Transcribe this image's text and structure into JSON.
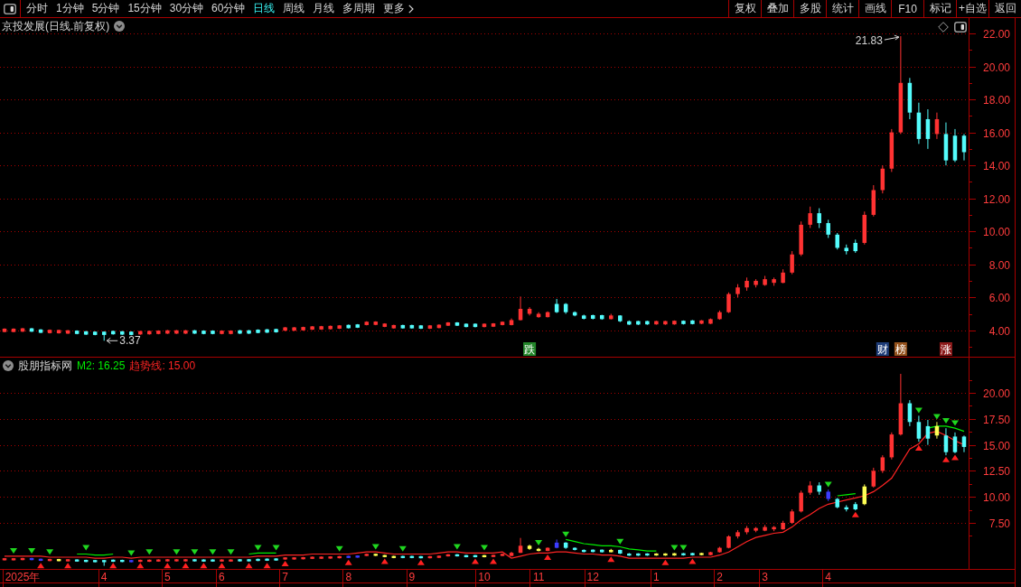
{
  "toolbar": {
    "periods": [
      {
        "label": "分时",
        "kind": "period",
        "selected": false
      },
      {
        "label": "1分钟",
        "kind": "period",
        "selected": false
      },
      {
        "label": "5分钟",
        "kind": "period",
        "selected": false
      },
      {
        "label": "15分钟",
        "kind": "period",
        "selected": false
      },
      {
        "label": "30分钟",
        "kind": "period",
        "selected": false
      },
      {
        "label": "60分钟",
        "kind": "period",
        "selected": false
      },
      {
        "label": "日线",
        "kind": "period",
        "selected": true
      },
      {
        "label": "周线",
        "kind": "period",
        "selected": false
      },
      {
        "label": "月线",
        "kind": "period",
        "selected": false
      },
      {
        "label": "多周期",
        "kind": "period",
        "selected": false
      },
      {
        "label": "更多",
        "kind": "menu",
        "selected": false
      }
    ],
    "buttons": [
      "复权",
      "叠加",
      "多股",
      "统计",
      "画线",
      "F10",
      "标记",
      "+自选",
      "返回"
    ]
  },
  "price_pane": {
    "title": "京投发展(日线.前复权)",
    "event_tags": [
      {
        "color": "#23862a"
      },
      {
        "color": "#1e3c78"
      },
      {
        "color": "#94521c"
      },
      {
        "color": "#8c1a1a"
      }
    ],
    "chart_data": [
      {
        "type": "candlestick",
        "ylim": [
          2.4,
          22.93
        ],
        "yticks": [
          {
            "value": 4,
            "label": "4.00"
          },
          {
            "value": 6,
            "label": "6.00"
          },
          {
            "value": 8,
            "label": "8.00"
          },
          {
            "value": 10,
            "label": "10.00"
          },
          {
            "value": 12,
            "label": "12.00"
          },
          {
            "value": 14,
            "label": "14.00"
          },
          {
            "value": 16,
            "label": "16.00"
          },
          {
            "value": 18,
            "label": "18.00"
          },
          {
            "value": 20,
            "label": "20.00"
          },
          {
            "value": 22,
            "label": "22.00"
          }
        ],
        "grid": true,
        "categories": [
          null,
          null,
          null,
          null,
          null,
          null,
          null,
          null,
          null,
          null,
          null,
          null,
          null,
          null,
          null,
          null,
          null,
          null,
          null,
          null,
          null,
          null,
          null,
          null,
          null,
          null,
          null,
          null,
          null,
          null,
          null,
          null,
          null,
          null,
          null,
          null,
          null,
          null,
          null,
          null,
          null,
          null,
          null,
          null,
          null,
          null,
          null,
          null,
          null,
          null,
          null,
          null,
          null,
          null,
          null,
          null,
          null,
          null,
          "跌",
          null,
          null,
          null,
          null,
          null,
          null,
          null,
          null,
          null,
          null,
          null,
          null,
          null,
          null,
          null,
          null,
          null,
          null,
          null,
          null,
          null,
          null,
          null,
          null,
          null,
          null,
          null,
          null,
          null,
          null,
          null,
          null,
          null,
          null,
          null,
          null,
          null,
          null,
          "财",
          null,
          "榜",
          null,
          null,
          null,
          null,
          "涨",
          null,
          null
        ],
        "ohlc": [
          [
            3.9,
            4.12,
            3.88,
            4.1
          ],
          [
            3.9,
            4.12,
            3.88,
            4.1
          ],
          [
            3.92,
            4.14,
            3.9,
            4.12
          ],
          [
            4.12,
            4.14,
            3.9,
            3.92
          ],
          [
            4.05,
            4.07,
            3.83,
            3.85
          ],
          [
            3.83,
            4.05,
            3.81,
            4.03
          ],
          [
            3.82,
            4.04,
            3.8,
            4.02
          ],
          [
            3.8,
            4.02,
            3.78,
            4.0
          ],
          [
            3.98,
            4.0,
            3.76,
            3.78
          ],
          [
            3.94,
            3.96,
            3.72,
            3.74
          ],
          [
            3.92,
            3.94,
            3.7,
            3.72
          ],
          [
            3.92,
            3.94,
            3.37,
            3.72
          ],
          [
            3.96,
            3.98,
            3.74,
            3.76
          ],
          [
            3.94,
            3.96,
            3.72,
            3.74
          ],
          [
            3.92,
            3.94,
            3.7,
            3.72
          ],
          [
            3.75,
            3.97,
            3.73,
            3.95
          ],
          [
            3.76,
            3.98,
            3.74,
            3.96
          ],
          [
            3.78,
            4.0,
            3.76,
            3.98
          ],
          [
            3.8,
            4.02,
            3.78,
            4.0
          ],
          [
            3.8,
            4.02,
            3.78,
            4.0
          ],
          [
            3.8,
            4.02,
            3.78,
            4.0
          ],
          [
            4.0,
            4.02,
            3.78,
            3.8
          ],
          [
            3.98,
            4.0,
            3.76,
            3.78
          ],
          [
            3.98,
            4.0,
            3.76,
            3.78
          ],
          [
            3.78,
            4.0,
            3.76,
            3.98
          ],
          [
            3.78,
            4.0,
            3.76,
            3.98
          ],
          [
            4.0,
            4.02,
            3.78,
            3.8
          ],
          [
            4.0,
            4.02,
            3.78,
            3.8
          ],
          [
            4.04,
            4.06,
            3.82,
            3.84
          ],
          [
            4.06,
            4.08,
            3.84,
            3.86
          ],
          [
            4.08,
            4.1,
            3.86,
            3.88
          ],
          [
            3.98,
            4.2,
            3.96,
            4.18
          ],
          [
            3.98,
            4.2,
            3.96,
            4.18
          ],
          [
            4.0,
            4.22,
            3.98,
            4.2
          ],
          [
            4.04,
            4.26,
            4.02,
            4.24
          ],
          [
            4.05,
            4.27,
            4.03,
            4.25
          ],
          [
            4.07,
            4.29,
            4.05,
            4.27
          ],
          [
            4.1,
            4.32,
            4.08,
            4.3
          ],
          [
            4.33,
            4.35,
            4.11,
            4.13
          ],
          [
            4.36,
            4.38,
            4.14,
            4.16
          ],
          [
            4.32,
            4.55,
            4.3,
            4.52
          ],
          [
            4.33,
            4.55,
            4.31,
            4.53
          ],
          [
            4.21,
            4.43,
            4.19,
            4.41
          ],
          [
            4.12,
            4.34,
            4.1,
            4.32
          ],
          [
            4.32,
            4.34,
            4.1,
            4.12
          ],
          [
            4.32,
            4.34,
            4.1,
            4.12
          ],
          [
            4.3,
            4.32,
            4.08,
            4.1
          ],
          [
            4.1,
            4.32,
            4.08,
            4.3
          ],
          [
            4.14,
            4.36,
            4.12,
            4.34
          ],
          [
            4.28,
            4.5,
            4.26,
            4.48
          ],
          [
            4.48,
            4.5,
            4.26,
            4.28
          ],
          [
            4.4,
            4.42,
            4.18,
            4.2
          ],
          [
            4.4,
            4.42,
            4.18,
            4.2
          ],
          [
            4.2,
            4.42,
            4.18,
            4.4
          ],
          [
            4.22,
            4.44,
            4.2,
            4.42
          ],
          [
            4.32,
            4.54,
            4.3,
            4.52
          ],
          [
            4.32,
            4.72,
            4.3,
            4.62
          ],
          [
            4.62,
            6.05,
            4.6,
            5.3
          ],
          [
            5.0,
            5.4,
            4.9,
            5.3
          ],
          [
            4.8,
            5.1,
            4.76,
            5.0
          ],
          [
            4.8,
            5.15,
            4.78,
            5.1
          ],
          [
            5.6,
            5.9,
            5.05,
            5.1
          ],
          [
            5.6,
            5.65,
            5.0,
            5.1
          ],
          [
            5.1,
            5.15,
            4.85,
            4.9
          ],
          [
            4.9,
            4.95,
            4.66,
            4.7
          ],
          [
            4.92,
            4.95,
            4.66,
            4.7
          ],
          [
            4.92,
            4.94,
            4.64,
            4.68
          ],
          [
            4.68,
            5.0,
            4.66,
            4.9
          ],
          [
            4.9,
            4.92,
            4.5,
            4.55
          ],
          [
            4.55,
            4.6,
            4.32,
            4.35
          ],
          [
            4.56,
            4.58,
            4.32,
            4.35
          ],
          [
            4.56,
            4.58,
            4.33,
            4.36
          ],
          [
            4.36,
            4.58,
            4.34,
            4.56
          ],
          [
            4.36,
            4.58,
            4.33,
            4.56
          ],
          [
            4.36,
            4.6,
            4.34,
            4.58
          ],
          [
            4.58,
            4.6,
            4.35,
            4.38
          ],
          [
            4.6,
            4.62,
            4.36,
            4.38
          ],
          [
            4.4,
            4.62,
            4.38,
            4.6
          ],
          [
            4.4,
            4.72,
            4.38,
            4.68
          ],
          [
            4.68,
            5.2,
            4.64,
            5.1
          ],
          [
            5.1,
            6.3,
            5.05,
            6.2
          ],
          [
            6.2,
            6.8,
            6.0,
            6.6
          ],
          [
            6.6,
            7.2,
            6.4,
            7.0
          ],
          [
            6.75,
            7.1,
            6.6,
            7.0
          ],
          [
            6.75,
            7.3,
            6.7,
            7.1
          ],
          [
            6.88,
            7.2,
            6.7,
            7.1
          ],
          [
            6.88,
            7.7,
            6.85,
            7.5
          ],
          [
            7.5,
            8.8,
            7.4,
            8.6
          ],
          [
            8.6,
            10.6,
            8.5,
            10.4
          ],
          [
            10.4,
            11.5,
            10.2,
            11.1
          ],
          [
            11.1,
            11.4,
            10.2,
            10.5
          ],
          [
            10.5,
            10.7,
            9.6,
            9.8
          ],
          [
            9.8,
            9.9,
            8.9,
            9.0
          ],
          [
            9.0,
            9.2,
            8.6,
            8.8
          ],
          [
            9.3,
            9.5,
            8.7,
            8.8
          ],
          [
            9.3,
            11.2,
            9.2,
            11.0
          ],
          [
            11.0,
            12.8,
            10.9,
            12.5
          ],
          [
            12.5,
            14.0,
            12.3,
            13.8
          ],
          [
            13.8,
            16.2,
            13.6,
            16.0
          ],
          [
            16.0,
            21.83,
            15.9,
            19.0
          ],
          [
            19.0,
            19.3,
            16.8,
            17.2
          ],
          [
            17.2,
            17.8,
            15.3,
            15.6
          ],
          [
            16.8,
            17.4,
            15.0,
            15.6
          ],
          [
            15.9,
            17.2,
            15.6,
            16.8
          ],
          [
            15.9,
            16.6,
            14.0,
            14.3
          ],
          [
            15.8,
            16.2,
            14.2,
            14.3
          ],
          [
            15.8,
            15.9,
            14.3,
            14.8
          ]
        ],
        "annotations": [
          "21.83",
          "3.37"
        ]
      }
    ]
  },
  "indicator_pane": {
    "name": "股朋指标网",
    "legend": [
      {
        "text": "M2: 16.25",
        "color": "#00ee00"
      },
      {
        "text": "趋势线: 15.00",
        "color": "#ff2424"
      }
    ],
    "chart_data": [
      {
        "type": "candlestick",
        "ylim": [
          3.07,
          23.39
        ],
        "yticks": [
          {
            "value": 7.5,
            "label": "7.50"
          },
          {
            "value": 10,
            "label": "10.00"
          },
          {
            "value": 12.5,
            "label": "12.50"
          },
          {
            "value": 15,
            "label": "15.00"
          },
          {
            "value": 17.5,
            "label": "17.50"
          },
          {
            "value": 20,
            "label": "20.00"
          }
        ],
        "grid": true,
        "categories": [
          null,
          null,
          "2025年",
          null,
          null,
          null,
          null,
          null,
          null,
          null,
          null,
          "4",
          null,
          null,
          null,
          null,
          null,
          null,
          "5",
          null,
          null,
          null,
          null,
          null,
          "6",
          null,
          null,
          null,
          null,
          null,
          null,
          "7",
          null,
          null,
          null,
          null,
          null,
          null,
          "8",
          null,
          null,
          null,
          null,
          null,
          null,
          "9",
          null,
          null,
          null,
          null,
          null,
          null,
          null,
          "10",
          null,
          null,
          null,
          null,
          null,
          "11",
          null,
          null,
          null,
          null,
          null,
          "12",
          null,
          null,
          null,
          null,
          null,
          null,
          "1",
          null,
          null,
          null,
          null,
          null,
          null,
          "2",
          null,
          null,
          null,
          null,
          "3",
          null,
          null,
          null,
          null,
          null,
          null,
          "4",
          null,
          null,
          null,
          null,
          null,
          null,
          null,
          null,
          null,
          null,
          null,
          null,
          null,
          null,
          null
        ],
        "ohlc": [
          [
            3.9,
            4.12,
            3.88,
            4.1
          ],
          [
            3.9,
            4.12,
            3.88,
            4.1
          ],
          [
            3.92,
            4.14,
            3.9,
            4.12
          ],
          [
            4.12,
            4.14,
            3.9,
            3.92
          ],
          [
            4.05,
            4.07,
            3.83,
            3.85
          ],
          [
            3.83,
            4.05,
            3.81,
            4.03
          ],
          [
            3.82,
            4.04,
            3.8,
            4.02
          ],
          [
            3.8,
            4.02,
            3.78,
            4.0
          ],
          [
            3.98,
            4.0,
            3.76,
            3.78
          ],
          [
            3.94,
            3.96,
            3.72,
            3.74
          ],
          [
            3.92,
            3.94,
            3.7,
            3.72
          ],
          [
            3.92,
            3.94,
            3.37,
            3.72
          ],
          [
            3.96,
            3.98,
            3.74,
            3.76
          ],
          [
            3.94,
            3.96,
            3.72,
            3.74
          ],
          [
            3.92,
            3.94,
            3.7,
            3.72
          ],
          [
            3.75,
            3.97,
            3.73,
            3.95
          ],
          [
            3.76,
            3.98,
            3.74,
            3.96
          ],
          [
            3.78,
            4.0,
            3.76,
            3.98
          ],
          [
            3.8,
            4.02,
            3.78,
            4.0
          ],
          [
            3.8,
            4.02,
            3.78,
            4.0
          ],
          [
            3.8,
            4.02,
            3.78,
            4.0
          ],
          [
            4.0,
            4.02,
            3.78,
            3.8
          ],
          [
            3.98,
            4.0,
            3.76,
            3.78
          ],
          [
            3.98,
            4.0,
            3.76,
            3.78
          ],
          [
            3.78,
            4.0,
            3.76,
            3.98
          ],
          [
            3.78,
            4.0,
            3.76,
            3.98
          ],
          [
            4.0,
            4.02,
            3.78,
            3.8
          ],
          [
            4.0,
            4.02,
            3.78,
            3.8
          ],
          [
            4.04,
            4.06,
            3.82,
            3.84
          ],
          [
            4.06,
            4.08,
            3.84,
            3.86
          ],
          [
            4.08,
            4.1,
            3.86,
            3.88
          ],
          [
            3.98,
            4.2,
            3.96,
            4.18
          ],
          [
            3.98,
            4.2,
            3.96,
            4.18
          ],
          [
            4.0,
            4.22,
            3.98,
            4.2
          ],
          [
            4.04,
            4.26,
            4.02,
            4.24
          ],
          [
            4.05,
            4.27,
            4.03,
            4.25
          ],
          [
            4.07,
            4.29,
            4.05,
            4.27
          ],
          [
            4.1,
            4.32,
            4.08,
            4.3
          ],
          [
            4.33,
            4.35,
            4.11,
            4.13
          ],
          [
            4.36,
            4.38,
            4.14,
            4.16
          ],
          [
            4.32,
            4.55,
            4.3,
            4.52
          ],
          [
            4.33,
            4.55,
            4.31,
            4.53
          ],
          [
            4.21,
            4.43,
            4.19,
            4.41
          ],
          [
            4.12,
            4.34,
            4.1,
            4.32
          ],
          [
            4.32,
            4.34,
            4.1,
            4.12
          ],
          [
            4.32,
            4.34,
            4.1,
            4.12
          ],
          [
            4.3,
            4.32,
            4.08,
            4.1
          ],
          [
            4.1,
            4.32,
            4.08,
            4.3
          ],
          [
            4.14,
            4.36,
            4.12,
            4.34
          ],
          [
            4.28,
            4.5,
            4.26,
            4.48
          ],
          [
            4.48,
            4.5,
            4.26,
            4.28
          ],
          [
            4.4,
            4.42,
            4.18,
            4.2
          ],
          [
            4.4,
            4.42,
            4.18,
            4.2
          ],
          [
            4.2,
            4.42,
            4.18,
            4.4
          ],
          [
            4.22,
            4.44,
            4.2,
            4.42
          ],
          [
            4.32,
            4.54,
            4.3,
            4.52
          ],
          [
            4.32,
            4.72,
            4.3,
            4.62
          ],
          [
            4.62,
            6.05,
            4.6,
            5.3
          ],
          [
            5.0,
            5.4,
            4.9,
            5.3
          ],
          [
            4.8,
            5.1,
            4.76,
            5.0
          ],
          [
            4.8,
            5.15,
            4.78,
            5.1
          ],
          [
            5.6,
            5.9,
            5.05,
            5.1
          ],
          [
            5.6,
            5.65,
            5.0,
            5.1
          ],
          [
            5.1,
            5.15,
            4.85,
            4.9
          ],
          [
            4.9,
            4.95,
            4.66,
            4.7
          ],
          [
            4.92,
            4.95,
            4.66,
            4.7
          ],
          [
            4.92,
            4.94,
            4.64,
            4.68
          ],
          [
            4.68,
            5.0,
            4.66,
            4.9
          ],
          [
            4.9,
            4.92,
            4.5,
            4.55
          ],
          [
            4.55,
            4.6,
            4.32,
            4.35
          ],
          [
            4.56,
            4.58,
            4.32,
            4.35
          ],
          [
            4.56,
            4.58,
            4.33,
            4.36
          ],
          [
            4.36,
            4.58,
            4.34,
            4.56
          ],
          [
            4.36,
            4.58,
            4.33,
            4.56
          ],
          [
            4.36,
            4.6,
            4.34,
            4.58
          ],
          [
            4.58,
            4.6,
            4.35,
            4.38
          ],
          [
            4.6,
            4.62,
            4.36,
            4.38
          ],
          [
            4.4,
            4.62,
            4.38,
            4.6
          ],
          [
            4.4,
            4.72,
            4.38,
            4.68
          ],
          [
            4.68,
            5.2,
            4.64,
            5.1
          ],
          [
            5.1,
            6.3,
            5.05,
            6.2
          ],
          [
            6.2,
            6.8,
            6.0,
            6.6
          ],
          [
            6.6,
            7.2,
            6.4,
            7.0
          ],
          [
            6.75,
            7.1,
            6.6,
            7.0
          ],
          [
            6.75,
            7.3,
            6.7,
            7.1
          ],
          [
            6.88,
            7.2,
            6.7,
            7.1
          ],
          [
            6.88,
            7.7,
            6.85,
            7.5
          ],
          [
            7.5,
            8.8,
            7.4,
            8.6
          ],
          [
            8.6,
            10.6,
            8.5,
            10.4
          ],
          [
            10.4,
            11.5,
            10.2,
            11.1
          ],
          [
            11.1,
            11.4,
            10.2,
            10.5
          ],
          [
            10.5,
            10.7,
            9.6,
            9.8
          ],
          [
            9.8,
            9.9,
            8.9,
            9.0
          ],
          [
            9.0,
            9.2,
            8.6,
            8.8
          ],
          [
            9.3,
            9.5,
            8.7,
            8.8
          ],
          [
            9.3,
            11.2,
            9.2,
            11.0
          ],
          [
            11.0,
            12.8,
            10.9,
            12.5
          ],
          [
            12.5,
            14.0,
            12.3,
            13.8
          ],
          [
            13.8,
            16.2,
            13.6,
            16.0
          ],
          [
            16.0,
            21.83,
            15.9,
            19.0
          ],
          [
            19.0,
            19.3,
            16.8,
            17.2
          ],
          [
            17.2,
            17.8,
            15.3,
            15.6
          ],
          [
            16.8,
            17.4,
            15.0,
            15.6
          ],
          [
            15.9,
            17.2,
            15.6,
            16.8
          ],
          [
            15.9,
            16.6,
            14.0,
            14.3
          ],
          [
            15.8,
            16.2,
            14.2,
            14.3
          ],
          [
            15.8,
            15.9,
            14.3,
            14.8
          ]
        ],
        "colors": [
          "#ff3232",
          "#ff3232",
          "#ff3232",
          "#3c3cff",
          "#3c3cff",
          "#ff3232",
          "#ffff54",
          "#ff3232",
          "#54fcfc",
          "#54fcfc",
          "#54fcfc",
          "#54fcfc",
          "#54fcfc",
          "#54fcfc",
          "#3c3cff",
          "#ff3232",
          "#ff3232",
          "#ff3232",
          "#ff3232",
          "#ff3232",
          "#ff3232",
          "#54fcfc",
          "#54fcfc",
          "#54fcfc",
          "#ff3232",
          "#ff3232",
          "#54fcfc",
          "#54fcfc",
          "#54fcfc",
          "#54fcfc",
          "#54fcfc",
          "#ff3232",
          "#ff3232",
          "#ff3232",
          "#ff3232",
          "#ff3232",
          "#ff3232",
          "#ff3232",
          "#3c3cff",
          "#3c3cff",
          "#ff3232",
          "#ffff54",
          "#ffff54",
          "#ffff54",
          "#54fcfc",
          "#54fcfc",
          "#54fcfc",
          "#ff3232",
          "#ff3232",
          "#ff3232",
          "#54fcfc",
          "#54fcfc",
          "#54fcfc",
          "#ffff54",
          "#ff3232",
          "#ff3232",
          "#ff3232",
          "#ff3232",
          "#ffff54",
          "#ffff54",
          "#ff3232",
          "#3c3cff",
          "#54fcfc",
          "#54fcfc",
          "#54fcfc",
          "#54fcfc",
          "#54fcfc",
          "#ffff54",
          "#54fcfc",
          "#54fcfc",
          "#54fcfc",
          "#54fcfc",
          "#ffff54",
          "#ffff54",
          "#ffff54",
          "#54fcfc",
          "#54fcfc",
          "#ffff54",
          "#ff3232",
          "#ff3232",
          "#ff3232",
          "#ff3232",
          "#ff3232",
          "#ff3232",
          "#ff3232",
          "#ff3232",
          "#ff3232",
          "#ff3232",
          "#ff3232",
          "#ff3232",
          "#54fcfc",
          "#3c3cff",
          "#54fcfc",
          "#54fcfc",
          "#54fcfc",
          "#ffff54",
          "#ff3232",
          "#ff3232",
          "#ff3232",
          "#ff3232",
          "#54fcfc",
          "#54fcfc",
          "#54fcfc",
          "#ffff54",
          "#54fcfc",
          "#54fcfc",
          "#54fcfc"
        ],
        "series": [
          {
            "type": "line",
            "color": "#00ee00",
            "values": [
              null,
              null,
              null,
              null,
              null,
              null,
              null,
              null,
              4.5,
              4.5,
              4.4,
              4.4,
              4.5,
              null,
              null,
              null,
              null,
              null,
              null,
              null,
              null,
              null,
              null,
              null,
              null,
              null,
              null,
              4.5,
              4.6,
              4.6,
              4.6,
              null,
              null,
              null,
              null,
              null,
              null,
              null,
              null,
              null,
              null,
              null,
              null,
              null,
              null,
              null,
              null,
              null,
              null,
              null,
              null,
              null,
              null,
              null,
              null,
              null,
              null,
              null,
              null,
              null,
              null,
              null,
              5.9,
              5.7,
              5.5,
              5.4,
              5.3,
              5.3,
              5.2,
              5.0,
              4.9,
              4.8,
              4.8,
              null,
              null,
              null,
              null,
              null,
              null,
              null,
              null,
              null,
              null,
              null,
              null,
              null,
              null,
              null,
              null,
              null,
              null,
              null,
              10.1,
              10.2,
              10.3,
              null,
              null,
              null,
              null,
              null,
              null,
              null,
              16.6,
              16.8,
              16.8,
              16.6,
              16.3
            ]
          },
          {
            "type": "line",
            "color": "#ff2424",
            "values": [
              4.3,
              4.3,
              4.3,
              4.3,
              4.3,
              4.2,
              4.2,
              4.2,
              4.2,
              4.2,
              4.1,
              4.1,
              4.2,
              4.2,
              4.1,
              4.2,
              4.2,
              4.2,
              4.2,
              4.2,
              4.2,
              4.2,
              4.2,
              4.2,
              4.2,
              4.2,
              4.2,
              4.2,
              4.3,
              4.3,
              4.3,
              4.4,
              4.4,
              4.4,
              4.5,
              4.5,
              4.5,
              4.5,
              4.5,
              4.6,
              4.7,
              4.7,
              4.6,
              4.5,
              4.5,
              4.5,
              4.5,
              4.5,
              4.6,
              4.7,
              4.7,
              4.6,
              4.6,
              4.6,
              4.6,
              4.7,
              4.1,
              4.3,
              4.5,
              4.6,
              4.6,
              4.7,
              4.7,
              4.6,
              4.5,
              4.5,
              4.4,
              4.4,
              4.3,
              4.1,
              4.1,
              4.1,
              4.1,
              4.1,
              4.1,
              4.1,
              4.2,
              4.2,
              4.2,
              4.4,
              4.7,
              5.2,
              5.7,
              6.1,
              6.3,
              6.5,
              6.6,
              7.1,
              7.8,
              8.3,
              8.9,
              9.3,
              9.5,
              9.7,
              9.9,
              10.1,
              10.5,
              11.1,
              11.8,
              13.2,
              14.6,
              15.1,
              16.1,
              16.3,
              15.9,
              15.4,
              15.0
            ]
          },
          {
            "type": "scatter",
            "marker": "triangle",
            "color": "#1fd61f",
            "values": [
              null,
              4.8,
              null,
              4.8,
              null,
              4.7,
              null,
              null,
              null,
              5.1,
              null,
              null,
              null,
              null,
              4.6,
              null,
              4.7,
              null,
              null,
              4.7,
              null,
              4.7,
              null,
              4.7,
              null,
              4.7,
              null,
              null,
              5.1,
              null,
              5.1,
              null,
              null,
              null,
              null,
              null,
              null,
              5.0,
              null,
              null,
              null,
              5.2,
              null,
              null,
              5.0,
              null,
              null,
              null,
              null,
              null,
              5.2,
              null,
              null,
              5.1,
              null,
              null,
              null,
              null,
              null,
              5.6,
              null,
              null,
              6.4,
              null,
              null,
              null,
              null,
              null,
              5.7,
              null,
              null,
              null,
              null,
              null,
              5.1,
              5.1,
              null,
              null,
              null,
              null,
              null,
              null,
              null,
              null,
              null,
              null,
              null,
              null,
              null,
              null,
              null,
              11.2,
              null,
              null,
              null,
              null,
              null,
              null,
              null,
              null,
              null,
              18.3,
              null,
              17.7,
              17.3,
              17.1,
              null
            ]
          },
          {
            "type": "scatter",
            "marker": "triangle",
            "color": "#ff2020",
            "values": [
              null,
              null,
              null,
              null,
              3.4,
              null,
              null,
              3.4,
              null,
              null,
              null,
              null,
              3.4,
              null,
              null,
              3.4,
              null,
              null,
              3.4,
              null,
              3.4,
              null,
              3.4,
              null,
              3.4,
              null,
              null,
              3.4,
              null,
              3.4,
              null,
              3.6,
              null,
              null,
              null,
              null,
              null,
              null,
              3.7,
              null,
              null,
              null,
              3.8,
              null,
              null,
              null,
              3.7,
              null,
              null,
              null,
              null,
              null,
              3.8,
              null,
              3.8,
              null,
              null,
              null,
              null,
              null,
              4.2,
              null,
              null,
              null,
              null,
              null,
              null,
              4.0,
              null,
              null,
              null,
              null,
              null,
              3.7,
              null,
              null,
              3.8,
              null,
              null,
              null,
              null,
              null,
              null,
              null,
              null,
              null,
              null,
              null,
              null,
              null,
              null,
              null,
              null,
              null,
              8.3,
              null,
              null,
              null,
              null,
              null,
              null,
              14.7,
              null,
              null,
              13.6,
              13.8,
              null
            ]
          }
        ]
      }
    ]
  }
}
